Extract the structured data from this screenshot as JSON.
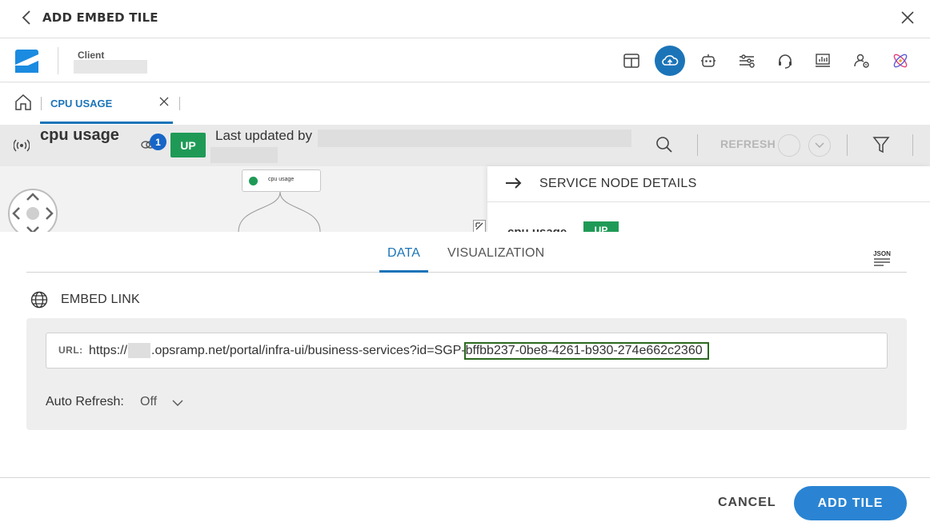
{
  "modal": {
    "title": "ADD EMBED TILE",
    "back_icon": "chevron-left-icon",
    "close_icon": "close-icon"
  },
  "preview": {
    "client_label": "Client",
    "app_icons": [
      "layout-icon",
      "cloud-icon",
      "robot-icon",
      "sliders-icon",
      "headset-icon",
      "monitor-icon",
      "user-settings-icon",
      "atom-icon"
    ],
    "active_app_icon": "cloud-icon",
    "tab": {
      "label": "CPU USAGE"
    },
    "service": {
      "name": "cpu usage",
      "link_count": "1",
      "status": "UP",
      "last_updated_label": "Last updated by",
      "refresh_label": "REFRESH"
    },
    "node": {
      "label": "cpu usage"
    },
    "details": {
      "title": "SERVICE NODE DETAILS",
      "name": "cpu usage",
      "status": "UP"
    }
  },
  "config": {
    "tabs": [
      {
        "label": "DATA",
        "active": true
      },
      {
        "label": "VISUALIZATION",
        "active": false
      }
    ],
    "json_label": "JSON",
    "embed_link_title": "EMBED LINK",
    "url_label": "URL:",
    "url_prefix": "https://",
    "url_mid": ".opsramp.net/portal/infra-ui/business-services?id=SGP-",
    "url_highlight": "bffbb237-0be8-4261-b930-274e662c2360",
    "auto_refresh_label": "Auto Refresh:",
    "auto_refresh_value": "Off"
  },
  "footer": {
    "cancel_label": "CANCEL",
    "add_label": "ADD TILE"
  },
  "colors": {
    "accent": "#1b74b8",
    "button": "#2a84d3",
    "status_up": "#1f9a56",
    "highlight_outline": "#2b6a1f"
  }
}
